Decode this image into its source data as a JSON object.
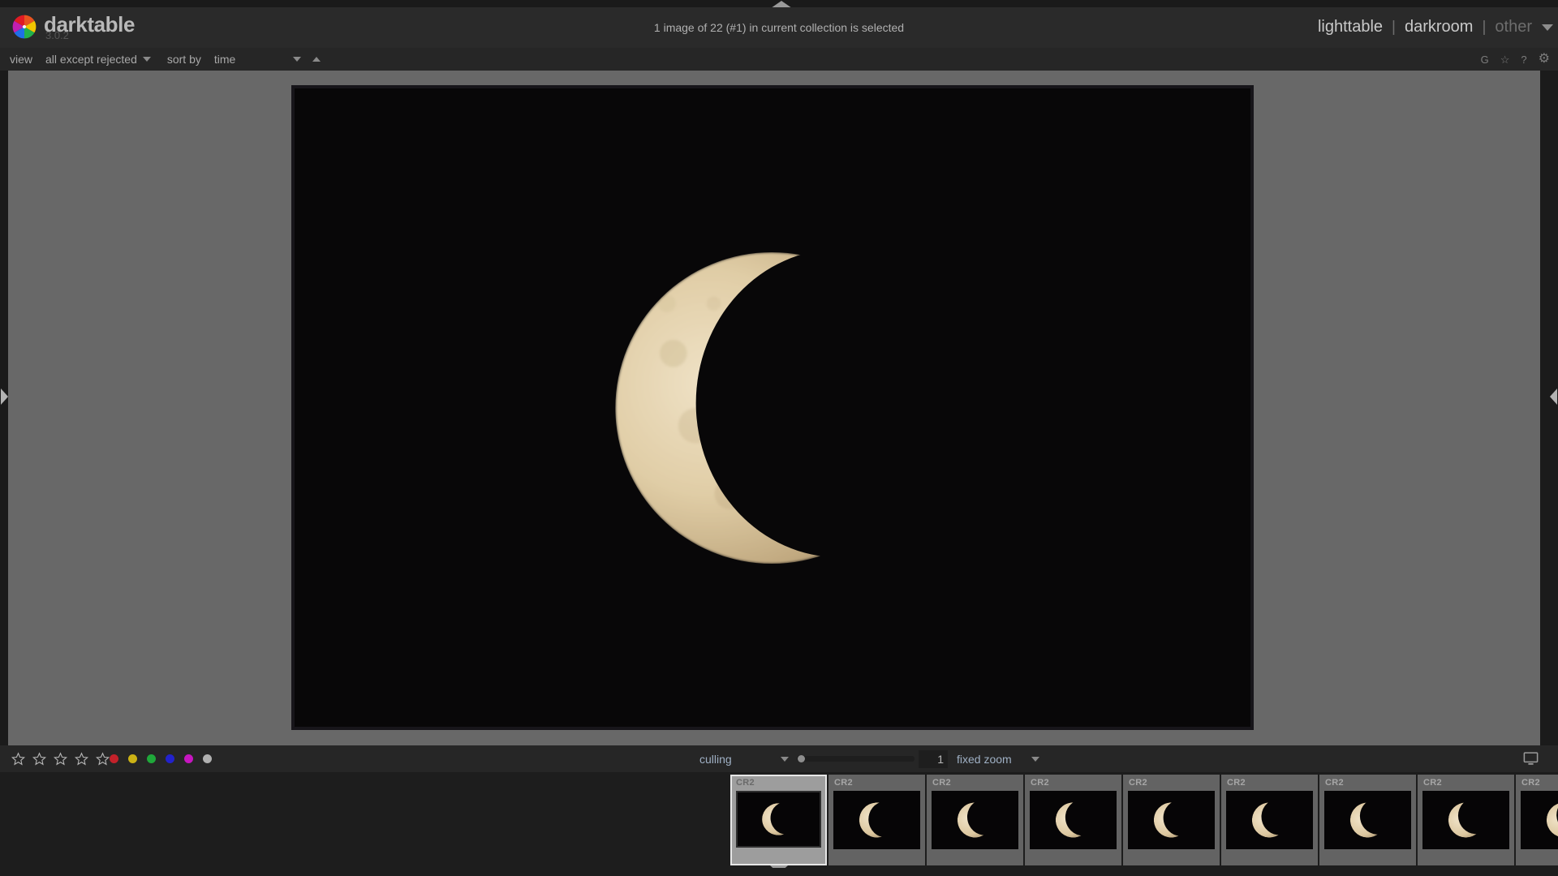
{
  "app": {
    "name": "darktable",
    "version": "3.0.2",
    "logo_icon": "darktable-aperture-logo"
  },
  "header": {
    "status_text": "1 image of 22 (#1) in current collection is selected",
    "views": [
      {
        "label": "lighttable",
        "active": true
      },
      {
        "label": "darkroom",
        "active": true
      },
      {
        "label": "other",
        "active": false
      }
    ],
    "separator": "|",
    "view_dropdown_icon": "chevron-down-icon"
  },
  "toolbar": {
    "view_label": "view",
    "filter_value": "all except rejected",
    "sort_by_label": "sort by",
    "sort_field": "time",
    "sort_direction_icon": "sort-ascending-icon",
    "icons": [
      {
        "name": "grouping-icon",
        "glyph": "G"
      },
      {
        "name": "overlays-star-icon",
        "glyph": "☆"
      },
      {
        "name": "help-icon",
        "glyph": "?"
      },
      {
        "name": "preferences-gear-icon",
        "glyph": "⚙"
      }
    ]
  },
  "bottom_bar": {
    "star_count": 5,
    "stars_filled": 0,
    "color_labels": [
      {
        "name": "red",
        "hex": "#c3212a"
      },
      {
        "name": "yellow",
        "hex": "#ccb215"
      },
      {
        "name": "green",
        "hex": "#1fa83a"
      },
      {
        "name": "blue",
        "hex": "#2222cc"
      },
      {
        "name": "magenta",
        "hex": "#c616c0"
      },
      {
        "name": "gray",
        "hex": "#b0b0b0"
      }
    ],
    "layout_mode": "culling",
    "zoom_value": "1",
    "zoom_mode": "fixed zoom",
    "zoom_slider_percent": 0,
    "display_profile_icon": "monitor-icon"
  },
  "filmstrip": {
    "thumbnails": [
      {
        "ext": "CR2",
        "selected": true,
        "phase": 0.1,
        "angle": -8
      },
      {
        "ext": "CR2",
        "selected": false,
        "phase": 0.12,
        "angle": -4
      },
      {
        "ext": "CR2",
        "selected": false,
        "phase": 0.22,
        "angle": -16
      },
      {
        "ext": "CR2",
        "selected": false,
        "phase": 0.2,
        "angle": -14
      },
      {
        "ext": "CR2",
        "selected": false,
        "phase": 0.17,
        "angle": -12
      },
      {
        "ext": "CR2",
        "selected": false,
        "phase": 0.19,
        "angle": -18
      },
      {
        "ext": "CR2",
        "selected": false,
        "phase": 0.24,
        "angle": -20
      },
      {
        "ext": "CR2",
        "selected": false,
        "phase": 0.26,
        "angle": -22
      },
      {
        "ext": "CR2",
        "selected": false,
        "phase": 0.3,
        "angle": -24
      }
    ]
  },
  "main_image": {
    "subject": "waning-crescent-moon",
    "background_hex": "#080708",
    "moon_hex": "#d8c5a2"
  },
  "colors": {
    "panel_bg": "#262626",
    "header_bg": "#2a2a2a",
    "canvas_bg": "#686868",
    "app_bg": "#1d1d1d",
    "text": "#b4b4b4"
  }
}
